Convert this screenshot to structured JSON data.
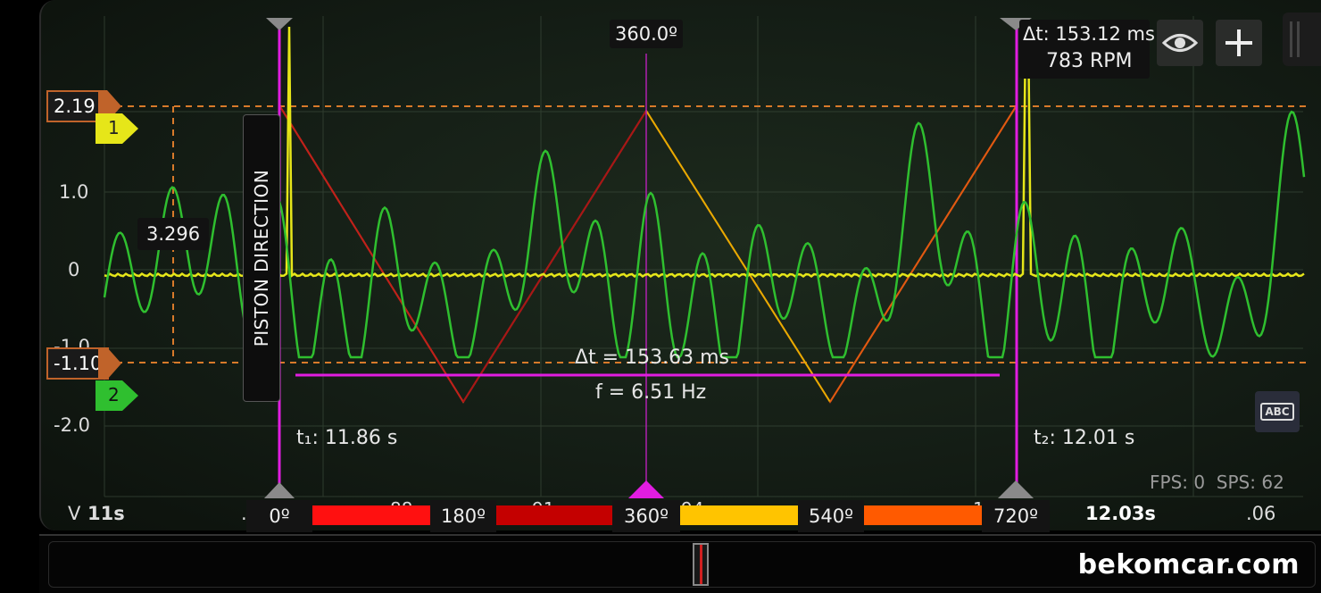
{
  "scope": {
    "angle_top_label": "360.0º",
    "delta_top": "Δt: 153.12 ms",
    "rpm": "783 RPM",
    "piston_label": "PISTON DIRECTION",
    "cursor_value": "3.296",
    "delta_mid": "Δt = 153.63 ms",
    "freq": "f = 6.51 Hz",
    "t1": "t₁: 11.86 s",
    "t2": "t₂: 12.01 s",
    "stats": "FPS: 0  SPS: 62"
  },
  "y_axis": {
    "ticks": [
      "1.0",
      "0",
      "-1.0",
      "-2.0"
    ],
    "cursor_high": "2.19",
    "cursor_low": "-1.10",
    "channel_1": "1",
    "channel_2": "2"
  },
  "x_axis": {
    "unit": "V",
    "left": "11s",
    "dot_left": ".",
    "label_88": "88",
    "label_91": "91",
    "label_94": "94",
    "label_1": "1",
    "right_bold": "12.03s",
    "right": ".06"
  },
  "degree_bar": {
    "labels": [
      "0º",
      "180º",
      "360º",
      "540º",
      "720º"
    ],
    "colors": [
      "#ff1010",
      "#c40000",
      "#ffc400",
      "#ff5a00"
    ]
  },
  "buttons": {
    "eye": "eye-icon",
    "add": "plus-icon",
    "abc": "ABC"
  },
  "colors": {
    "channel_1": "#e6e619",
    "channel_2": "#2fbf2f",
    "cursor_magenta": "#e11de1",
    "cursor_orange": "#d87a2a"
  },
  "watermark": "bekomcar.com"
}
